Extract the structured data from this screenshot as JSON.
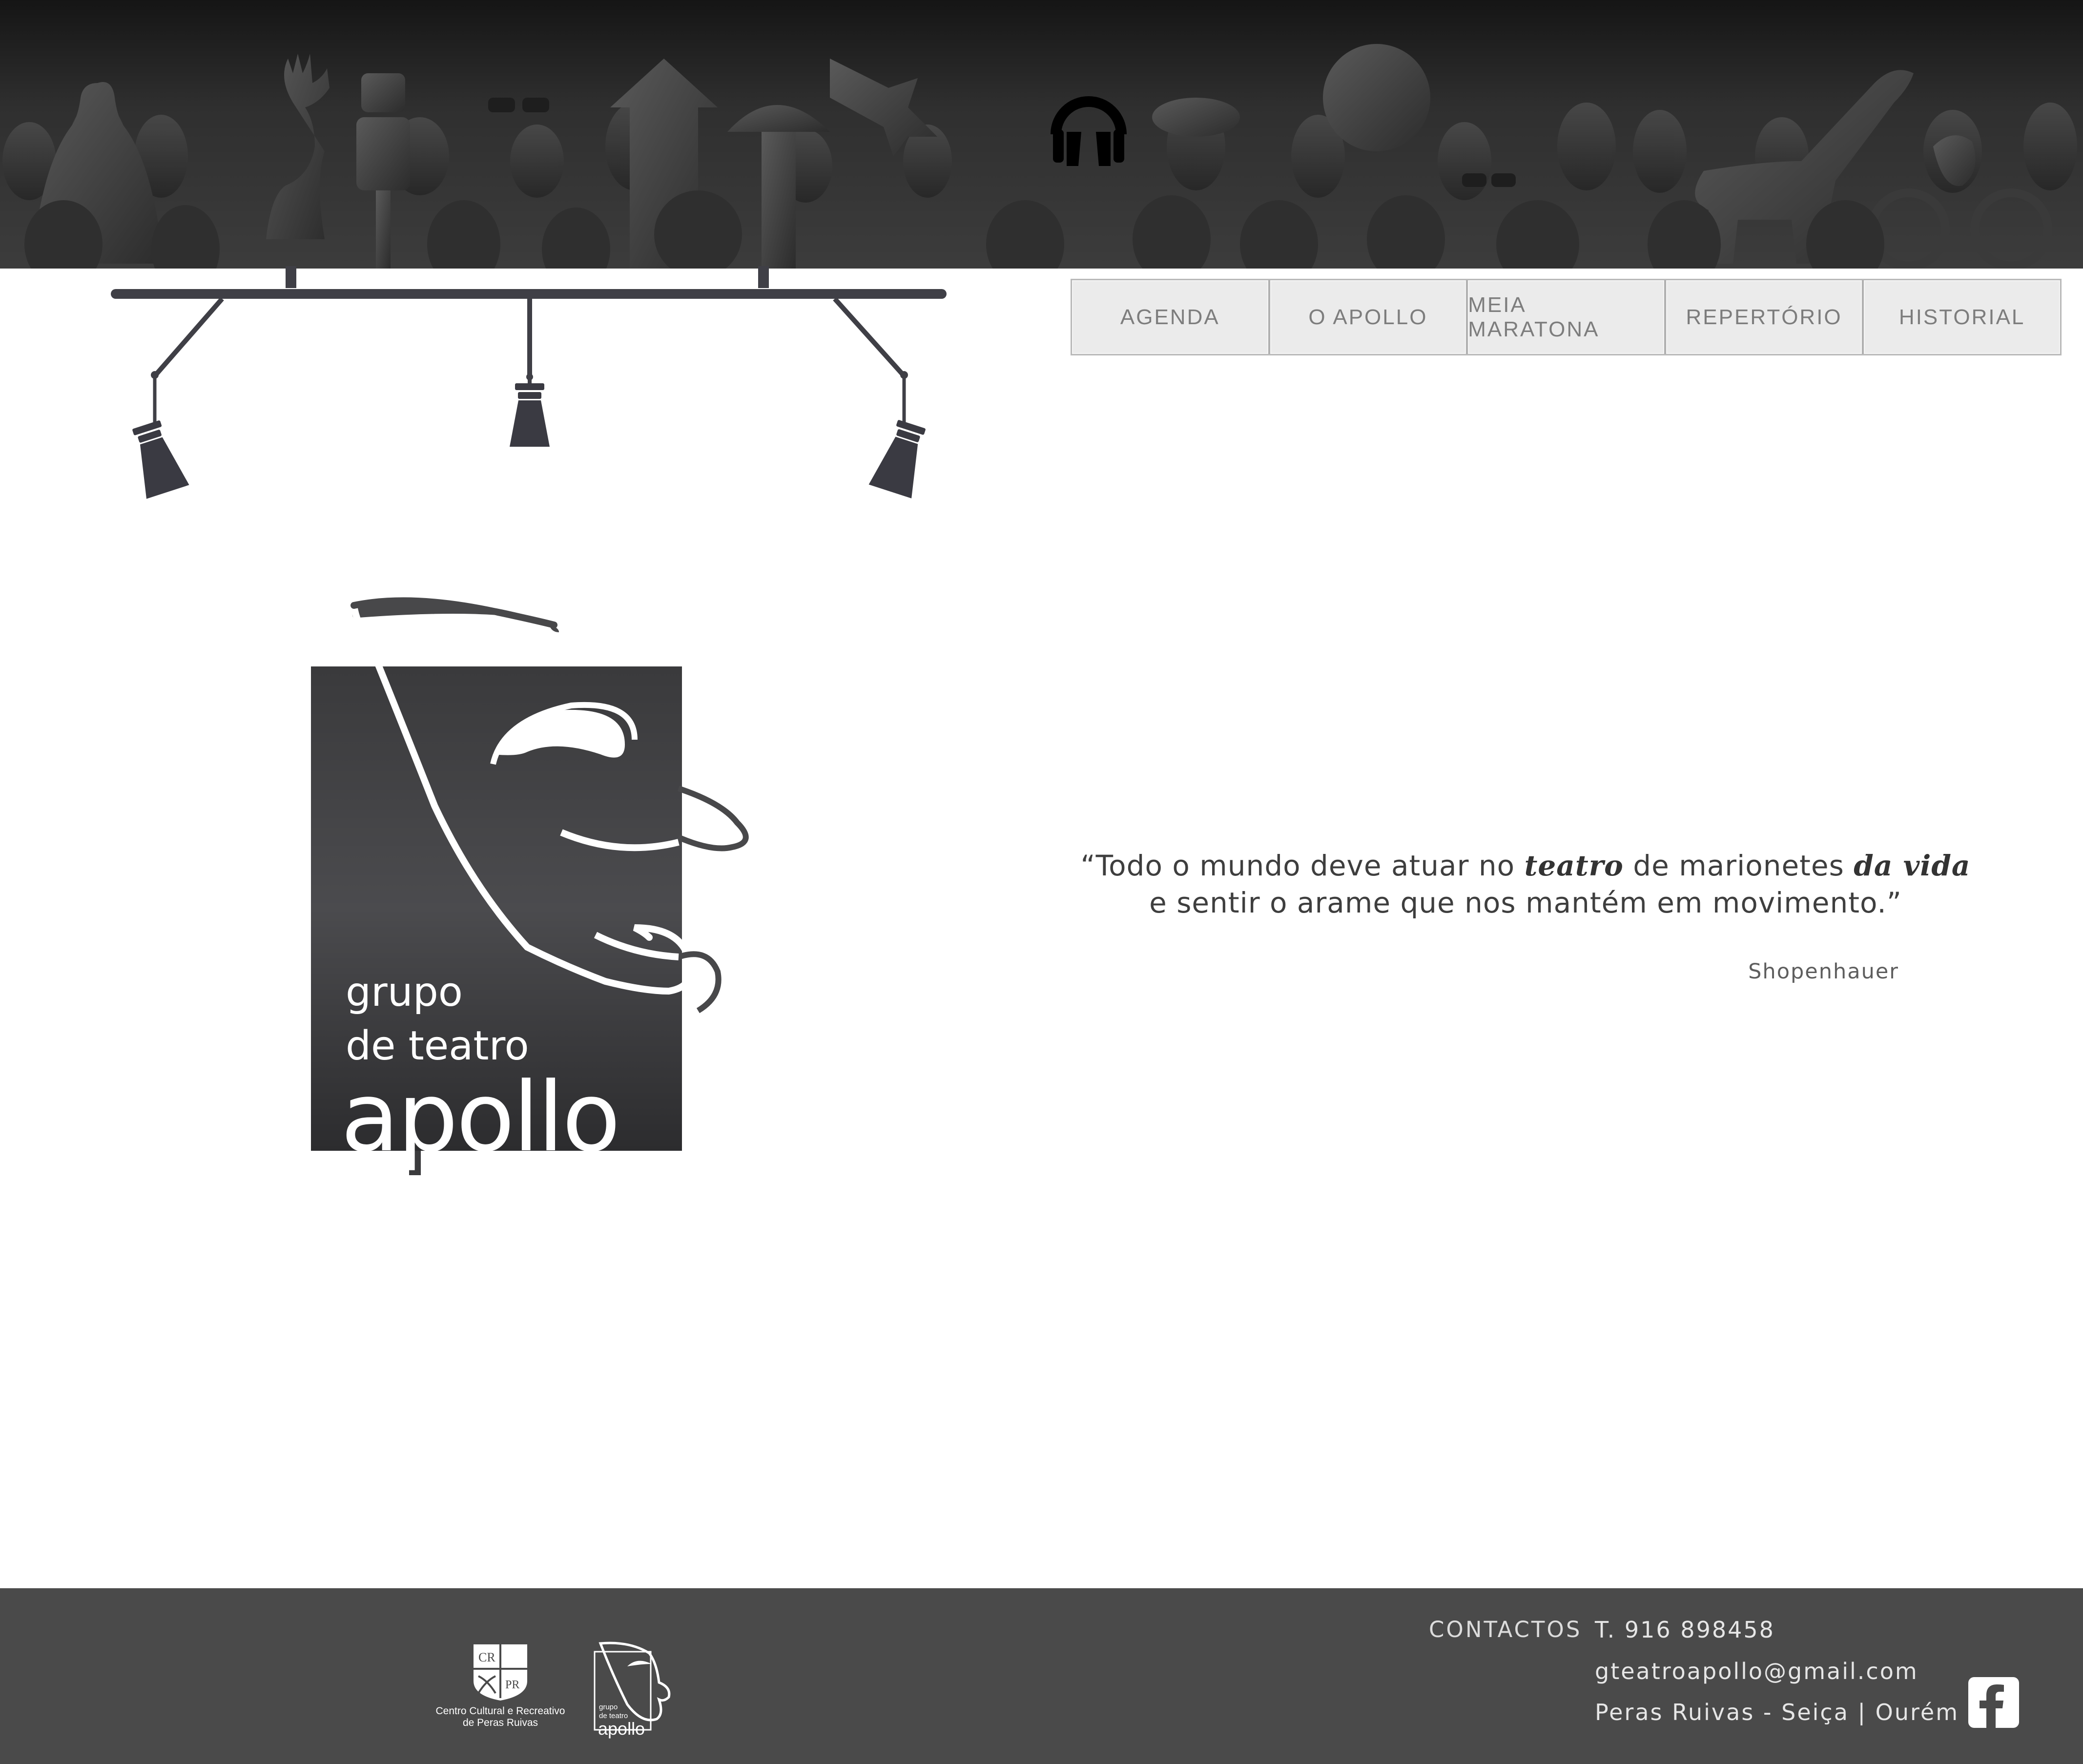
{
  "nav": {
    "items": [
      {
        "label": "AGENDA"
      },
      {
        "label": "O APOLLO"
      },
      {
        "label": "MEIA MARATONA"
      },
      {
        "label": "REPERTÓRIO"
      },
      {
        "label": "HISTORIAL"
      }
    ]
  },
  "logo": {
    "line1": "grupo",
    "line2": "de teatro",
    "line3": "apollo"
  },
  "quote": {
    "part1": "“Todo o mundo deve atuar no ",
    "em1": "teatro",
    "part2": " de marionetes ",
    "em2": "da vida",
    "line2": "e sentir o arame que nos mantém em movimento.”",
    "author": "Shopenhauer"
  },
  "footer": {
    "ccr_name_line1": "Centro Cultural e Recreativo",
    "ccr_name_line2": "de Peras Ruivas",
    "ccr_badge_tl": "CR",
    "ccr_badge_br": "PR",
    "apollo_small_line1": "grupo",
    "apollo_small_line2": "de teatro",
    "apollo_small_line3": "apollo",
    "contacts_label": "CONTACTOS",
    "phone": "T. 916 898458",
    "email": "gteatroapollo@gmail.com",
    "address": "Peras Ruivas - Seiça | Ourém"
  },
  "icons": {
    "audio": "headphones-icon",
    "social": "facebook-icon"
  },
  "colors": {
    "banner_dark": "#1a1a1a",
    "banner_light": "#3c3c3c",
    "nav_bg": "#ebebeb",
    "nav_text": "#7d7d7d",
    "logo_square": "#3d3d3f",
    "footer_bg": "#4a4a4a",
    "quote_text": "#3e3e3e"
  }
}
